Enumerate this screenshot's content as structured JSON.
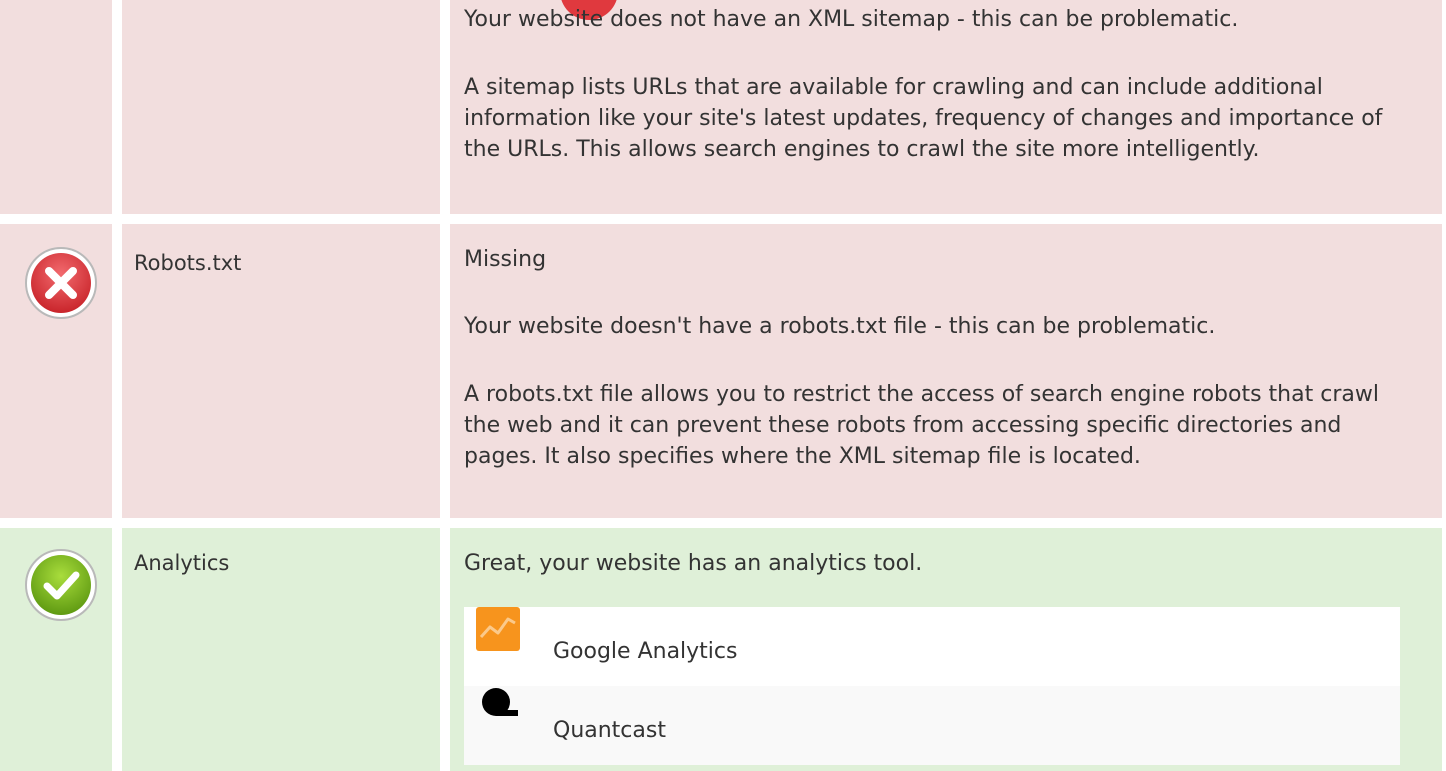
{
  "rows": {
    "sitemap": {
      "status": "error",
      "description": "Your website does not have an XML sitemap - this can be problematic.",
      "details": "A sitemap lists URLs that are available for crawling and can include additional information like your site's latest updates, frequency of changes and importance of the URLs. This allows search engines to crawl the site more intelligently."
    },
    "robots": {
      "status": "error",
      "label": "Robots.txt",
      "result": "Missing",
      "description": "Your website doesn't have a robots.txt file - this can be problematic.",
      "details": "A robots.txt file allows you to restrict the access of search engine robots that crawl the web and it can prevent these robots from accessing specific directories and pages. It also specifies where the XML sitemap file is located."
    },
    "analytics": {
      "status": "ok",
      "label": "Analytics",
      "description": "Great, your website has an analytics tool.",
      "tools": [
        {
          "name": "Google Analytics",
          "icon": "google-analytics-icon"
        },
        {
          "name": "Quantcast",
          "icon": "quantcast-icon"
        }
      ]
    }
  },
  "colors": {
    "error_bg": "#f2dede",
    "ok_bg": "#dff0d8",
    "error_icon": "#e0393e",
    "ok_icon": "#7ab51d",
    "ga_orange": "#f7941d"
  }
}
